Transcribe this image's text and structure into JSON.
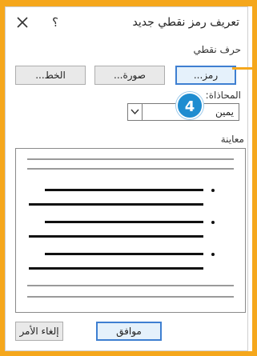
{
  "dialog": {
    "title": "تعريف رمز نقطي جديد",
    "help_glyph": "؟",
    "close_icon": "close-icon"
  },
  "bullet_char": {
    "label": "حرف نقطي",
    "symbol_button": "رمز...",
    "picture_button": "صورة...",
    "font_button": "الخط..."
  },
  "alignment": {
    "label": "المحاذاة:",
    "value": "يمين"
  },
  "preview": {
    "label": "معاينة"
  },
  "callout": {
    "number": "4"
  },
  "footer": {
    "ok": "موافق",
    "cancel": "إلغاء الأمر"
  },
  "colors": {
    "frame": "#f5a71c",
    "badge": "#1e8cd0",
    "focus": "#3e7fd1"
  }
}
